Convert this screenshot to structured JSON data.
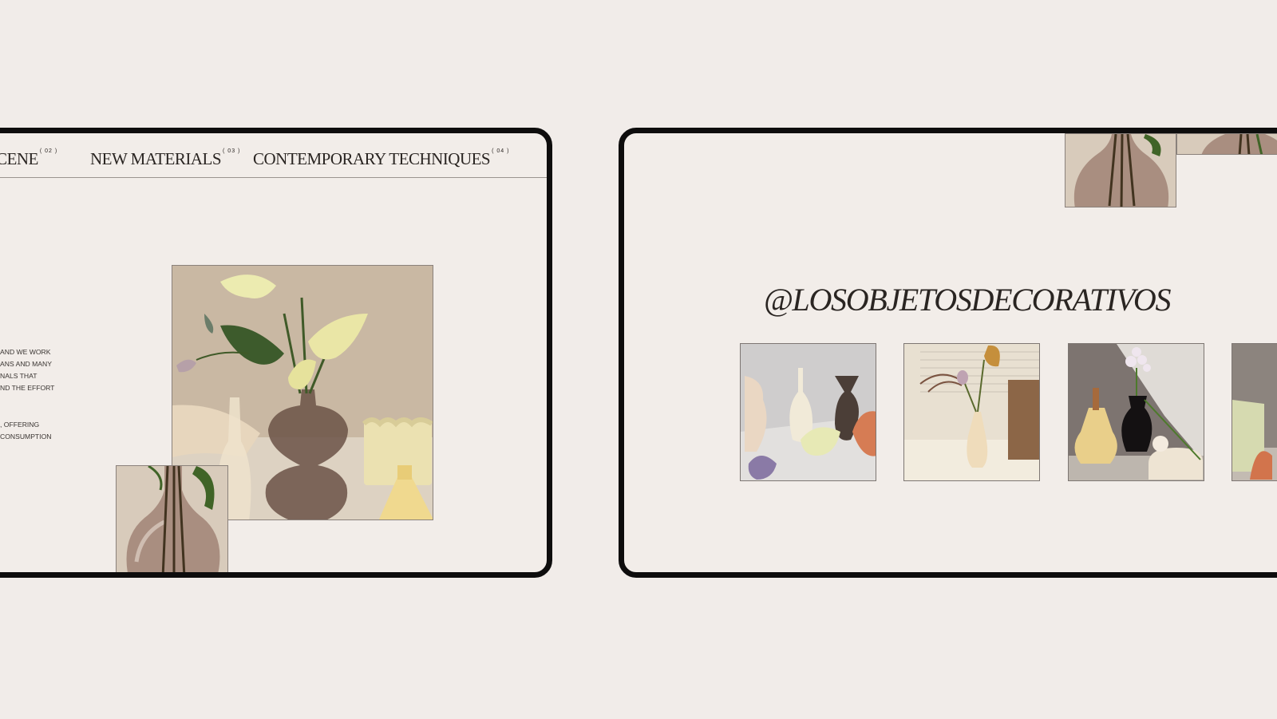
{
  "left_screen": {
    "nav": [
      {
        "label": "CENE",
        "num": "( 02 )"
      },
      {
        "label": "NEW MATERIALS",
        "num": "( 03 )"
      },
      {
        "label": "CONTEMPORARY TECHNIQUES",
        "num": "( 04 )"
      }
    ],
    "paragraph_1": [
      "AND WE WORK",
      "ANS AND MANY",
      "NALS THAT",
      "ND THE EFFORT"
    ],
    "paragraph_2": [
      ", OFFERING",
      "CONSUMPTION"
    ]
  },
  "right_screen": {
    "instagram_handle": "@LOSOBJETOSDECORATIVOS"
  },
  "colors": {
    "background": "#f1ece9",
    "screen": "#f2ede9",
    "frame": "#0e0d0d",
    "text": "#2a2522"
  },
  "icons": [
    "anthurium-photo",
    "glass-vase-photo",
    "objects-photo",
    "tulip-vase-photo",
    "black-vase-photo"
  ]
}
